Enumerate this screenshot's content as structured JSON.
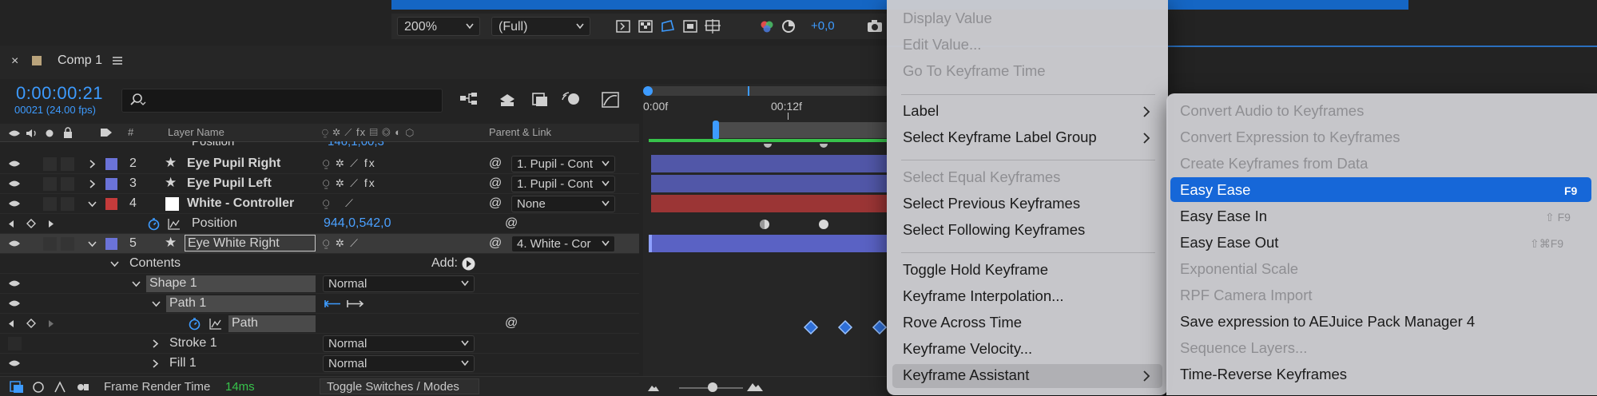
{
  "viewer": {
    "zoom": "200%",
    "resolution": "(Full)",
    "exposure": "+0,0"
  },
  "comp": {
    "tab_title": "Comp 1",
    "timecode": "0:00:00:21",
    "frames": "00021 (24.00 fps)"
  },
  "columns": {
    "hash": "#",
    "layer_name": "Layer Name",
    "parent_link": "Parent & Link"
  },
  "layers": {
    "row0_value": "146,1,00,3",
    "l2": {
      "num": "2",
      "name": "Eye Pupil Right",
      "parent": "1. Pupil - Cont",
      "color": "#6b73d8"
    },
    "l3": {
      "num": "3",
      "name": "Eye Pupil Left",
      "parent": "1. Pupil - Cont",
      "color": "#6b73d8"
    },
    "l4": {
      "num": "4",
      "name": "White - Controller",
      "parent": "None",
      "color": "#c43b3b"
    },
    "position": {
      "label": "Position",
      "value": "944,0,542,0"
    },
    "l5": {
      "num": "5",
      "name": "Eye White Right",
      "parent": "4. White - Cor",
      "color": "#6b73d8"
    },
    "contents": "Contents",
    "add": "Add:",
    "shape1": {
      "name": "Shape 1",
      "mode": "Normal"
    },
    "path1": "Path 1",
    "path": "Path",
    "stroke1": {
      "name": "Stroke 1",
      "mode": "Normal"
    },
    "fill1": {
      "name": "Fill 1",
      "mode": "Normal"
    }
  },
  "timeline": {
    "tick0": "0:00f",
    "tick1": "00:12f"
  },
  "status": {
    "render_label": "Frame Render Time",
    "render_value": "14ms",
    "toggle": "Toggle Switches / Modes"
  },
  "menu_main": {
    "display_value": "Display Value",
    "edit_value": "Edit Value...",
    "goto_kf": "Go To Keyframe Time",
    "label": "Label",
    "select_label_group": "Select Keyframe Label Group",
    "select_equal": "Select Equal Keyframes",
    "select_prev": "Select Previous Keyframes",
    "select_following": "Select Following Keyframes",
    "toggle_hold": "Toggle Hold Keyframe",
    "interpolation": "Keyframe Interpolation...",
    "rove": "Rove Across Time",
    "velocity": "Keyframe Velocity...",
    "assistant": "Keyframe Assistant"
  },
  "menu_sub": {
    "audio": "Convert Audio to Keyframes",
    "expression": "Convert Expression to Keyframes",
    "from_data": "Create Keyframes from Data",
    "easy_ease": "Easy Ease",
    "easy_ease_sc": "F9",
    "easy_in": "Easy Ease In",
    "easy_in_sc": "⇧ F9",
    "easy_out": "Easy Ease Out",
    "easy_out_sc": "⇧⌘F9",
    "exp_scale": "Exponential Scale",
    "rpf": "RPF Camera Import",
    "aejuice": "Save expression to AEJuice Pack Manager 4",
    "seq_layers": "Sequence Layers...",
    "time_reverse": "Time-Reverse Keyframes"
  },
  "colors": {
    "accent": "#3d9bff",
    "highlight": "#1667d8",
    "menu_bg": "#cbcbcf"
  }
}
